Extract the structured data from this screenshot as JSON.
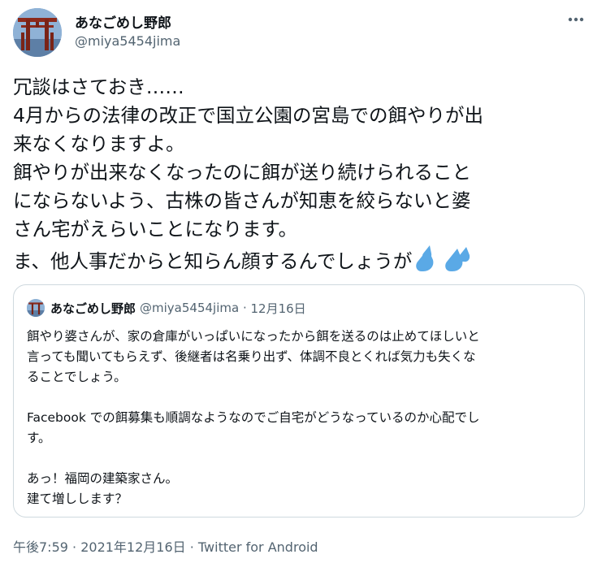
{
  "tweet": {
    "author_name": "あなごめし野郎",
    "author_handle": "@miya5454jima",
    "more_label": "···",
    "lines": [
      "冗談はさておき……",
      "4月からの法律の改正で国立公園の宮島での餌やりが出",
      "来なくなりますよ。",
      "餌やりが出来なくなったのに餌が送り続けられること",
      "にならないよう、古株の皆さんが知恵を絞らないと婆",
      "さん宅がえらいことになります。",
      "ま、他人事だからと知らん顔するんでしょうが"
    ],
    "emoji": "sweat-droplets-icon"
  },
  "quote": {
    "author_name": "あなごめし野郎",
    "author_handle": "@miya5454jima",
    "date_separator": " · ",
    "date": "12月16日",
    "lines": [
      "餌やり婆さんが、家の倉庫がいっぱいになったから餌を送るのは止めてほしいと",
      "言っても聞いてもらえず、後継者は名乗り出ず、体調不良とくれば気力も失くな",
      "ることでしょう。",
      "",
      "Facebook での餌募集も順調なようなのでご自宅がどうなっているのか心配でし",
      "す。",
      "",
      "あっ！福岡の建築家さん。",
      "建て増しします？"
    ]
  },
  "footer": {
    "time": "午後7:59",
    "separator": " · ",
    "date": "2021年12月16日",
    "source": "Twitter for Android"
  },
  "colors": {
    "text": "#0f1419",
    "secondary": "#536471",
    "border": "#cfd9de",
    "drop": "#5aa9e6"
  }
}
